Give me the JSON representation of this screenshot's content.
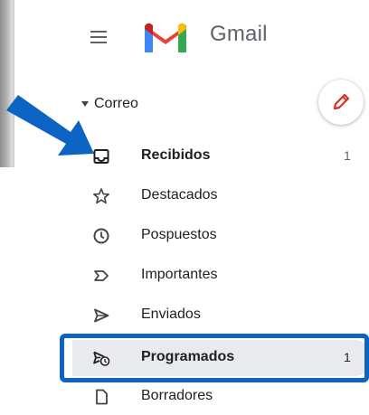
{
  "app": {
    "logo_text": "Gmail"
  },
  "section": {
    "label": "Correo"
  },
  "nav": {
    "items": [
      {
        "label": "Recibidos",
        "count": "1",
        "icon": "inbox-icon"
      },
      {
        "label": "Destacados",
        "count": "",
        "icon": "star-icon"
      },
      {
        "label": "Pospuestos",
        "count": "",
        "icon": "clock-icon"
      },
      {
        "label": "Importantes",
        "count": "",
        "icon": "important-icon"
      },
      {
        "label": "Enviados",
        "count": "",
        "icon": "send-icon"
      },
      {
        "label": "Programados",
        "count": "1",
        "icon": "scheduled-icon"
      },
      {
        "label": "Borradores",
        "count": "",
        "icon": "draft-icon"
      }
    ],
    "selected": "Programados"
  },
  "colors": {
    "annotation_blue": "#0b63c4",
    "selected_bg": "#e8eaed",
    "compose_pencil": "#d93025"
  }
}
